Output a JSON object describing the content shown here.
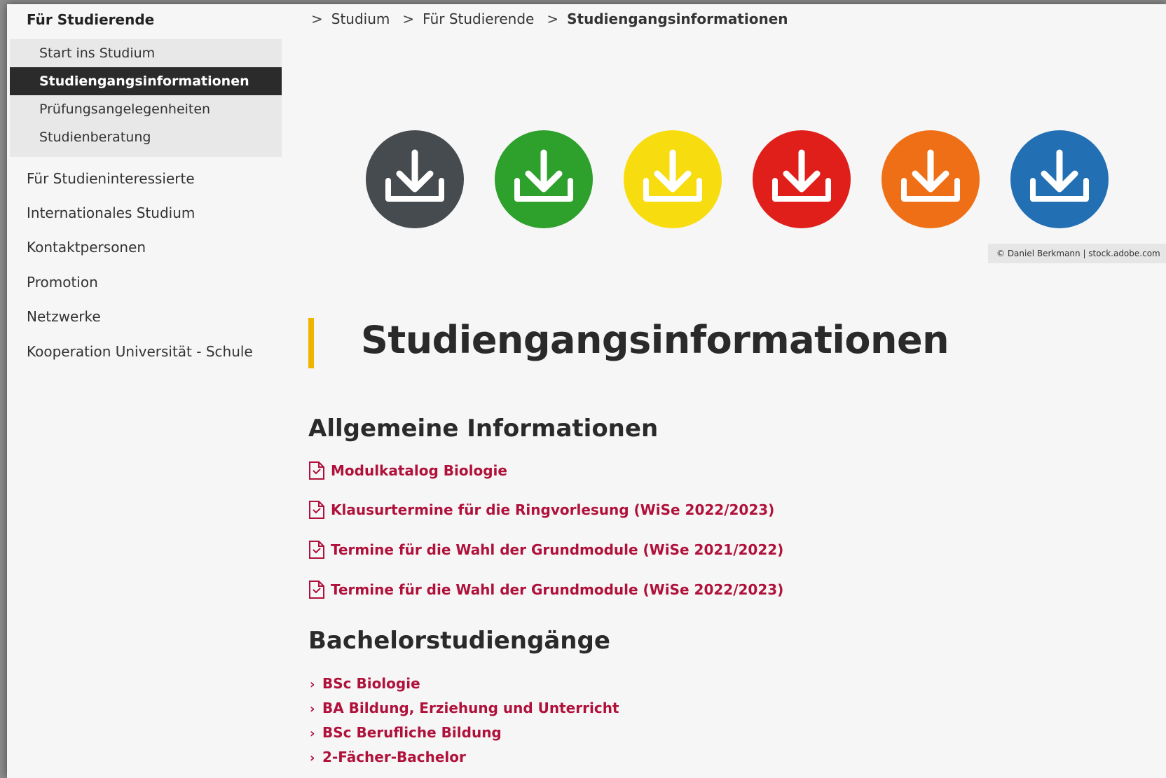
{
  "sidebar": {
    "section_title": "Für Studierende",
    "subnav": [
      {
        "label": "Start ins Studium",
        "active": false
      },
      {
        "label": "Studiengangsinformationen",
        "active": true
      },
      {
        "label": "Prüfungsangelegenheiten",
        "active": false
      },
      {
        "label": "Studienberatung",
        "active": false
      }
    ],
    "items": [
      {
        "label": "Für Studieninteressierte"
      },
      {
        "label": "Internationales Studium"
      },
      {
        "label": "Kontaktpersonen"
      },
      {
        "label": "Promotion"
      },
      {
        "label": "Netzwerke"
      },
      {
        "label": "Kooperation Universität - Schule"
      }
    ]
  },
  "breadcrumb": {
    "separator": ">",
    "items": [
      "Studium",
      "Für Studierende",
      "Studiengangsinformationen"
    ]
  },
  "hero": {
    "icons": [
      {
        "name": "download-icon",
        "color": "#464b4f"
      },
      {
        "name": "download-icon",
        "color": "#2ea02c"
      },
      {
        "name": "download-icon",
        "color": "#f7dd0f"
      },
      {
        "name": "download-icon",
        "color": "#e01f1a"
      },
      {
        "name": "download-icon",
        "color": "#ef6f16"
      },
      {
        "name": "download-icon",
        "color": "#236fb3"
      }
    ],
    "credit": "© Daniel Berkmann | stock.adobe.com"
  },
  "page": {
    "title": "Studiengangsinformationen",
    "accent_color": "#f0b400",
    "link_color": "#b0113a"
  },
  "general": {
    "heading": "Allgemeine Informationen",
    "links": [
      {
        "label": "Modulkatalog Biologie",
        "icon": "pdf-download-icon"
      },
      {
        "label": "Klausurtermine für die Ringvorlesung (WiSe 2022/2023)",
        "icon": "pdf-download-icon"
      },
      {
        "label": "Termine für die Wahl der Grundmodule (WiSe 2021/2022)",
        "icon": "pdf-download-icon"
      },
      {
        "label": "Termine für die Wahl der Grundmodule (WiSe 2022/2023)",
        "icon": "pdf-download-icon"
      }
    ]
  },
  "bachelor": {
    "heading": "Bachelorstudiengänge",
    "links": [
      {
        "label": "BSc Biologie"
      },
      {
        "label": "BA Bildung, Erziehung und Unterricht"
      },
      {
        "label": "BSc Berufliche Bildung"
      },
      {
        "label": "2-Fächer-Bachelor"
      }
    ]
  }
}
